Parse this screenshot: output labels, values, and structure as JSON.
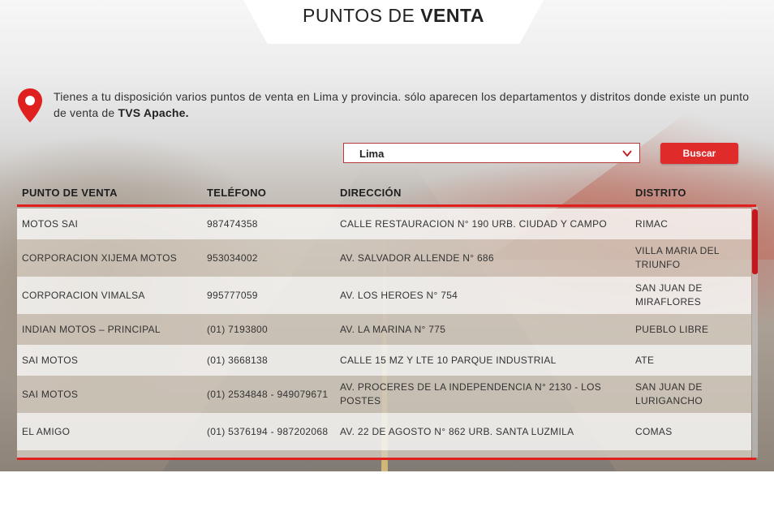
{
  "header": {
    "title_light": "PUNTOS DE ",
    "title_bold": "VENTA"
  },
  "intro": {
    "text": "Tienes a tu disposición varios puntos de venta en Lima y provincia. sólo aparecen los departamentos y distritos donde existe un punto de venta de ",
    "brand": "TVS Apache."
  },
  "search": {
    "selected_value": "Lima",
    "button_label": "Buscar"
  },
  "table": {
    "headers": [
      "PUNTO DE VENTA",
      "TELÉFONO",
      "DIRECCIÓN",
      "DISTRITO"
    ],
    "rows": [
      {
        "name": "MOTOS SAI",
        "phone": "987474358",
        "address": "CALLE RESTAURACION N° 190 URB. CIUDAD Y CAMPO",
        "district": "RIMAC"
      },
      {
        "name": "CORPORACION XIJEMA MOTOS",
        "phone": "953034002",
        "address": "AV. SALVADOR ALLENDE N° 686",
        "district": "VILLA MARIA DEL TRIUNFO"
      },
      {
        "name": "CORPORACION VIMALSA",
        "phone": "995777059",
        "address": "AV. LOS HEROES N° 754",
        "district": "SAN JUAN DE MIRAFLORES"
      },
      {
        "name": "INDIAN MOTOS – PRINCIPAL",
        "phone": "(01) 7193800",
        "address": "AV. LA MARINA N° 775",
        "district": "PUEBLO LIBRE"
      },
      {
        "name": "SAI MOTOS",
        "phone": "(01) 3668138",
        "address": "CALLE 15 MZ Y LTE 10 PARQUE INDUSTRIAL",
        "district": "ATE"
      },
      {
        "name": "SAI MOTOS",
        "phone": "(01) 2534848 - 949079671",
        "address": "AV. PROCERES DE LA INDEPENDENCIA N° 2130 - LOS POSTES",
        "district": "SAN JUAN DE LURIGANCHO"
      },
      {
        "name": "EL AMIGO",
        "phone": "(01) 5376194 - 987202068",
        "address": "AV. 22 DE AGOSTO N° 862 URB. SANTA LUZMILA",
        "district": "COMAS"
      }
    ]
  },
  "colors": {
    "accent": "#e01f1f",
    "button": "#e02b2b",
    "scroll_thumb": "#c4161c"
  }
}
